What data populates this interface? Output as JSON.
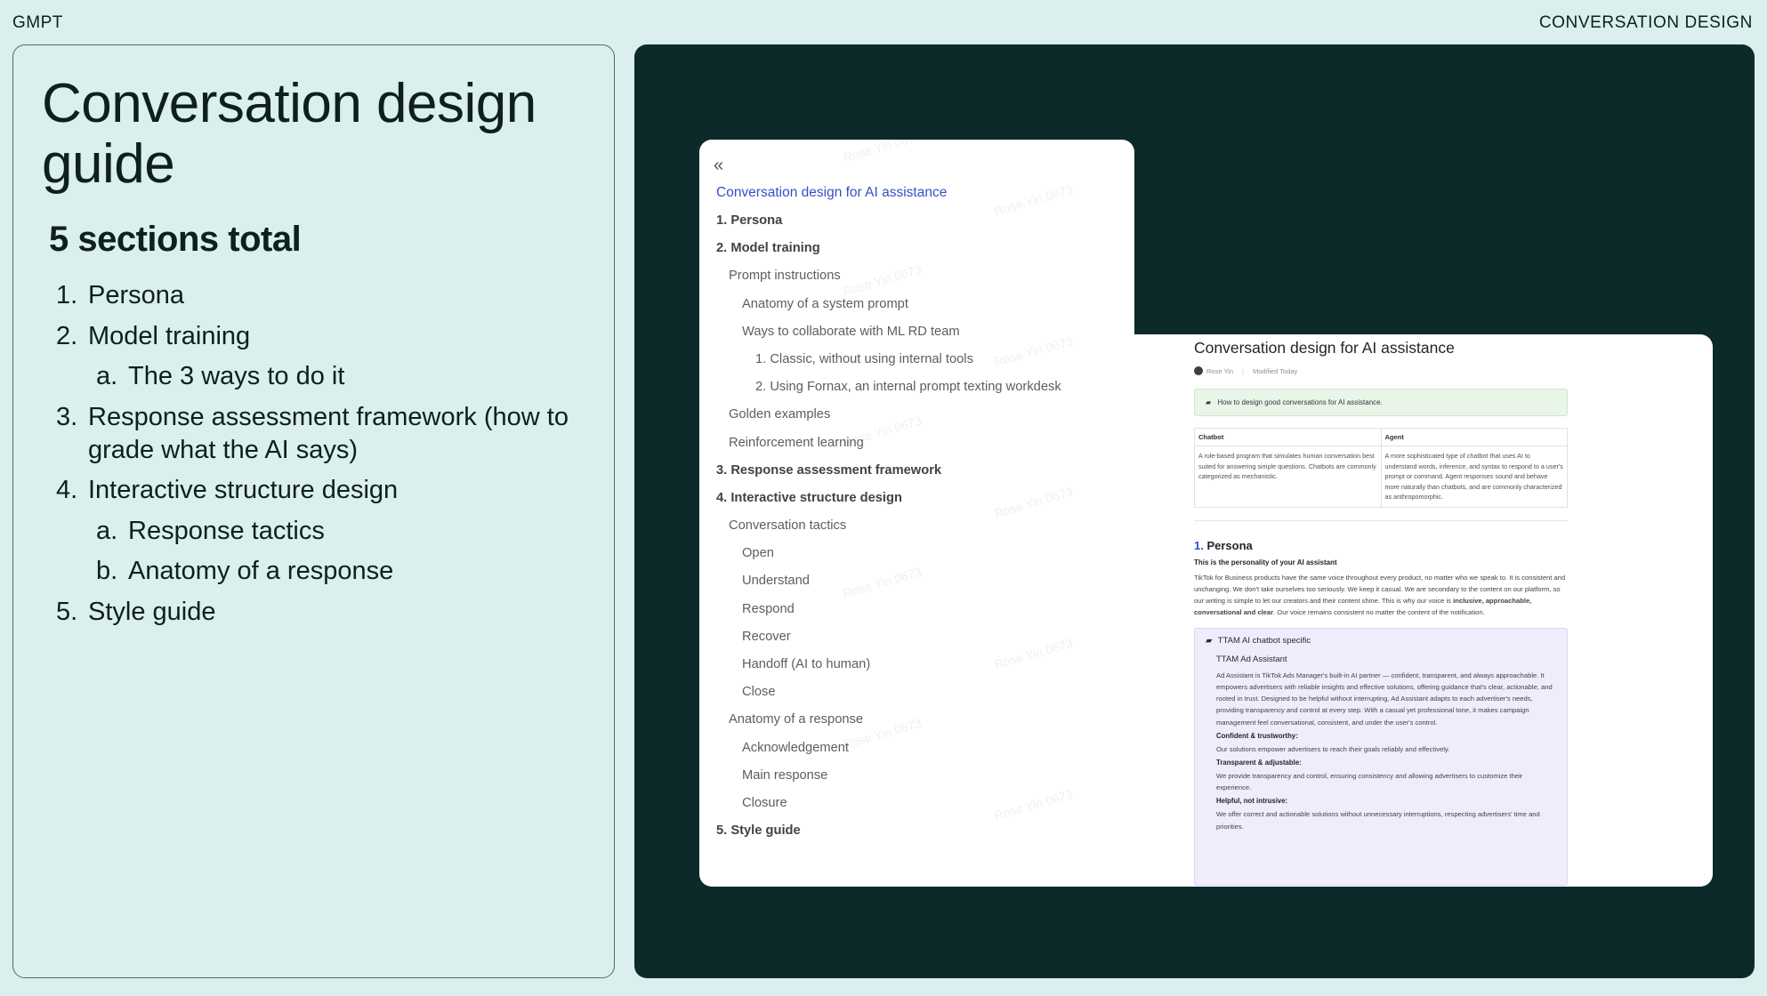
{
  "header": {
    "left": "GMPT",
    "right": "CONVERSATION DESIGN"
  },
  "left": {
    "title": "Conversation design guide",
    "subtitle": "5 sections total",
    "items": [
      {
        "num": "1.",
        "text": "Persona",
        "sub": false
      },
      {
        "num": "2.",
        "text": "Model training",
        "sub": false
      },
      {
        "num": "a.",
        "text": "The 3 ways to do it",
        "sub": true
      },
      {
        "num": "3.",
        "text": "Response assessment framework (how to grade what the AI says)",
        "sub": false
      },
      {
        "num": "4.",
        "text": "Interactive structure design",
        "sub": false
      },
      {
        "num": "a.",
        "text": "Response tactics",
        "sub": true
      },
      {
        "num": "b.",
        "text": "Anatomy of a response",
        "sub": true
      },
      {
        "num": "5.",
        "text": "Style guide",
        "sub": false
      }
    ]
  },
  "toc": {
    "collapse_icon": "double-chevron-left-icon",
    "title": "Conversation design for AI assistance",
    "items": [
      {
        "label": "1. Persona",
        "level": 0
      },
      {
        "label": "2. Model training",
        "level": 0
      },
      {
        "label": "Prompt instructions",
        "level": 1
      },
      {
        "label": "Anatomy of a system prompt",
        "level": 2
      },
      {
        "label": "Ways to collaborate with ML RD team",
        "level": 2
      },
      {
        "label": "1. Classic, without using internal tools",
        "level": 3
      },
      {
        "label": "2. Using Fornax, an internal prompt texting workdesk",
        "level": 3
      },
      {
        "label": "Golden examples",
        "level": 1
      },
      {
        "label": "Reinforcement learning",
        "level": 1
      },
      {
        "label": "3. Response assessment framework",
        "level": 0
      },
      {
        "label": "4. Interactive structure design",
        "level": 0
      },
      {
        "label": "Conversation tactics",
        "level": 1
      },
      {
        "label": "Open",
        "level": 2
      },
      {
        "label": "Understand",
        "level": 2
      },
      {
        "label": "Respond",
        "level": 2
      },
      {
        "label": "Recover",
        "level": 2
      },
      {
        "label": "Handoff (AI to human)",
        "level": 2
      },
      {
        "label": "Close",
        "level": 2
      },
      {
        "label": "Anatomy of a response",
        "level": 1
      },
      {
        "label": "Acknowledgement",
        "level": 2
      },
      {
        "label": "Main response",
        "level": 2
      },
      {
        "label": "Closure",
        "level": 2
      },
      {
        "label": "5. Style guide",
        "level": 0
      }
    ],
    "watermark": "Rose Yin 0673"
  },
  "doc": {
    "title": "Conversation design for AI assistance",
    "author": "Rose Yin",
    "modified": "Modified Today",
    "callout": "How to design good conversations for AI assistance.",
    "table": {
      "headers": [
        "Chatbot",
        "Agent"
      ],
      "cells": [
        "A rule-based program that simulates human conversation best suited for answering simple questions. Chatbots are commonly categorized as mechanistic.",
        "A more sophisticated type of chatbot that uses AI to understand words, inference, and syntax to respond to a user's prompt or command. Agent responses sound and behave more naturally than chatbots, and are commonly characterized as anthropomorphic."
      ]
    },
    "section_num": "1.",
    "section_title": "Persona",
    "section_bold": "This is the personality of your AI assistant",
    "para_a": "TikTok for Business products have the same voice throughout every product, no matter who we speak to. It is consistent and unchanging. We don't take ourselves too seriously. We keep it casual. We are secondary to the content on our platform, so our writing is simple to let our creators and their content shine. This is why our voice is ",
    "para_b": "inclusive, approachable, conversational and clear",
    "para_c": ". Our voice remains consistent no matter the content of the notification.",
    "purple": {
      "heading": "TTAM AI chatbot specific",
      "subheading": "TTAM Ad Assistant",
      "intro": "Ad Assistant is TikTok Ads Manager's built-in AI partner — confident, transparent, and always approachable. It empowers advertisers with reliable insights and effective solutions, offering guidance that's clear, actionable, and rooted in trust. Designed to be helpful without interrupting, Ad Assistant adapts to each advertiser's needs, providing transparency and control at every step. With a casual yet professional tone, it makes campaign management feel conversational, consistent, and under the user's control.",
      "traits": [
        {
          "name": "Confident & trustworthy:",
          "desc": "Our solutions empower advertisers to reach their goals reliably and effectively."
        },
        {
          "name": "Transparent & adjustable:",
          "desc": "We provide transparency and control, ensuring consistency and allowing advertisers to customize their experience."
        },
        {
          "name": "Helpful, not intrusive:",
          "desc": "We offer correct and actionable solutions without unnecessary interruptions, respecting advertisers' time and priorities."
        }
      ]
    }
  }
}
